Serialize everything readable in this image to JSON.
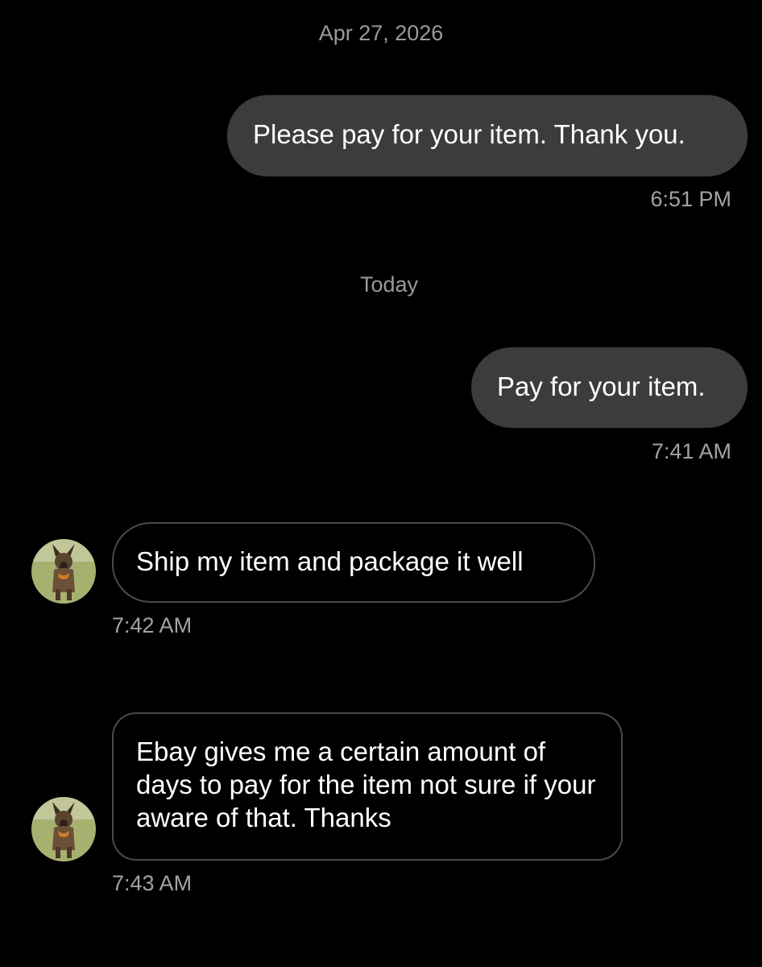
{
  "conversation": {
    "groups": [
      {
        "date": "Apr 27, 2026",
        "messages": [
          {
            "direction": "outgoing",
            "text": "Please pay for your item. Thank you.",
            "time": "6:51 PM"
          }
        ]
      },
      {
        "date": "Today",
        "messages": [
          {
            "direction": "outgoing",
            "text": "Pay for your item.",
            "time": "7:41 AM"
          },
          {
            "direction": "incoming",
            "text": "Ship my item and package it well",
            "time": "7:42 AM",
            "avatar": "dog-avatar"
          },
          {
            "direction": "incoming",
            "text": "Ebay gives me a certain amount of days to pay for the item not sure if your aware of that. Thanks",
            "time": "7:43 AM",
            "avatar": "dog-avatar"
          }
        ]
      }
    ]
  },
  "colors": {
    "background": "#000000",
    "outgoing_bubble": "#3c3c3c",
    "incoming_border": "#4a4a4a",
    "meta_text": "#9a9a9a"
  }
}
